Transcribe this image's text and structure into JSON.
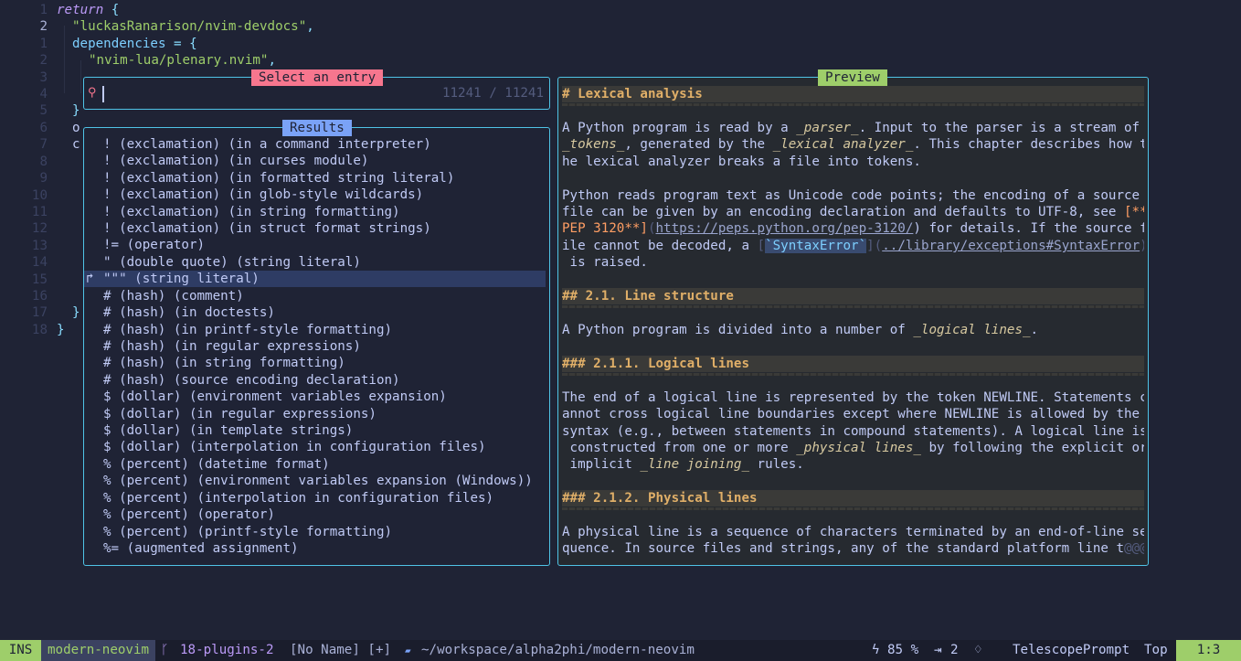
{
  "editor": {
    "line_numbers": [
      "1",
      "2",
      "1",
      "2",
      "3",
      "4",
      "5",
      "6",
      "7",
      "8",
      "9",
      "10",
      "11",
      "12",
      "13",
      "14",
      "15",
      "16",
      "17",
      "18"
    ],
    "code": {
      "l1_kw": "return",
      "l1_rest": " {",
      "l2": "\"luckasRanarison/nvim-devdocs\"",
      "l2_comma": ",",
      "l3_field": "dependencies",
      "l3_rest": " = {",
      "l4": "\"nvim-lua/plenary.nvim\"",
      "l4_comma": ",",
      "l5": "\"",
      "l7": "}",
      "l8": "o",
      "l9": "c",
      "l17": "}",
      "l18": "}"
    }
  },
  "prompt": {
    "title": "Select an entry",
    "prefix_icon": "telescope-icon",
    "prefix": "⚲",
    "counter": "11241 / 11241"
  },
  "results": {
    "title": "Results",
    "selected_index": 8,
    "caret": "↱",
    "items": [
      "! (exclamation) (in a command interpreter)",
      "! (exclamation) (in curses module)",
      "! (exclamation) (in formatted string literal)",
      "! (exclamation) (in glob-style wildcards)",
      "! (exclamation) (in string formatting)",
      "! (exclamation) (in struct format strings)",
      "!= (operator)",
      "\" (double quote) (string literal)",
      "\"\"\" (string literal)",
      "# (hash) (comment)",
      "# (hash) (in doctests)",
      "# (hash) (in printf-style formatting)",
      "# (hash) (in regular expressions)",
      "# (hash) (in string formatting)",
      "# (hash) (source encoding declaration)",
      "$ (dollar) (environment variables expansion)",
      "$ (dollar) (in regular expressions)",
      "$ (dollar) (in template strings)",
      "$ (dollar) (interpolation in configuration files)",
      "% (percent) (datetime format)",
      "% (percent) (environment variables expansion (Windows))",
      "% (percent) (interpolation in configuration files)",
      "% (percent) (operator)",
      "% (percent) (printf-style formatting)",
      "%= (augmented assignment)"
    ]
  },
  "preview": {
    "title": "Preview",
    "h1": "# Lexical analysis",
    "p1_l1": "A Python program is read by a ",
    "p1_l1_it": "_parser_",
    "p1_l1_end": ". Input to the parser is a stream of",
    "p1_l2_it": "_tokens_",
    "p1_l2_a": ", generated by the ",
    "p1_l2_it2": "_lexical analyzer_",
    "p1_l2_b": ". This chapter describes how t",
    "p1_l3": "he lexical analyzer breaks a file into tokens.",
    "p2_l1": "Python reads program text as Unicode code points; the encoding of a source",
    "p2_l2_a": "file can be given by an encoding declaration and defaults to UTF-8, see ",
    "p2_l2_b": "[**",
    "p2_l3_a": "PEP 3120**]",
    "p2_l3_b": "(",
    "p2_l3_link": "https://peps.python.org/pep-3120/",
    "p2_l3_c": ") for details. If the source f",
    "p2_l4_a": "ile cannot be decoded, a ",
    "p2_l4_b": "[",
    "p2_l4_code": "`SyntaxError`",
    "p2_l4_c": "](",
    "p2_l4_link": "../library/exceptions#SyntaxError",
    "p2_l4_d": ")",
    "p2_l5": " is raised.",
    "h2": "## 2.1. Line structure",
    "p3_a": "A Python program is divided into a number of ",
    "p3_it": "_logical lines_",
    "p3_b": ".",
    "h3a": "### 2.1.1. Logical lines",
    "p4_l1": "The end of a logical line is represented by the token NEWLINE. Statements c",
    "p4_l2": "annot cross logical line boundaries except where NEWLINE is allowed by the",
    "p4_l3": "syntax (e.g., between statements in compound statements). A logical line is",
    "p4_l4_a": " constructed from one or more ",
    "p4_l4_it": "_physical lines_",
    "p4_l4_b": " by following the explicit or",
    "p4_l5_a": " implicit ",
    "p4_l5_it": "_line joining_",
    "p4_l5_b": " rules.",
    "h3b": "### 2.1.2. Physical lines",
    "p5_l1": "A physical line is a sequence of characters terminated by an end-of-line se",
    "p5_l2": "quence. In source files and strings, any of the standard platform line t",
    "p5_l2_trunc": "@@@"
  },
  "statusline": {
    "mode": "INS",
    "project": "modern-neovim",
    "branch_icon": "git-branch-icon",
    "branch_glyph": "ᚴ",
    "branch": "18-plugins-2",
    "buffer": "[No Name] [+]",
    "folder_glyph": "▰",
    "path": "~/workspace/alpha2phi/modern-neovim",
    "bolt_glyph": "ϟ",
    "percent": "85 %",
    "arrow_glyph": "⇥",
    "count": "2",
    "bell_glyph": "♢",
    "filetype": "TelescopePrompt",
    "position": "Top",
    "cursor": "1:3",
    "colors": {
      "mode_bg": "#9ece6a",
      "project_bg": "#3b4261"
    }
  }
}
